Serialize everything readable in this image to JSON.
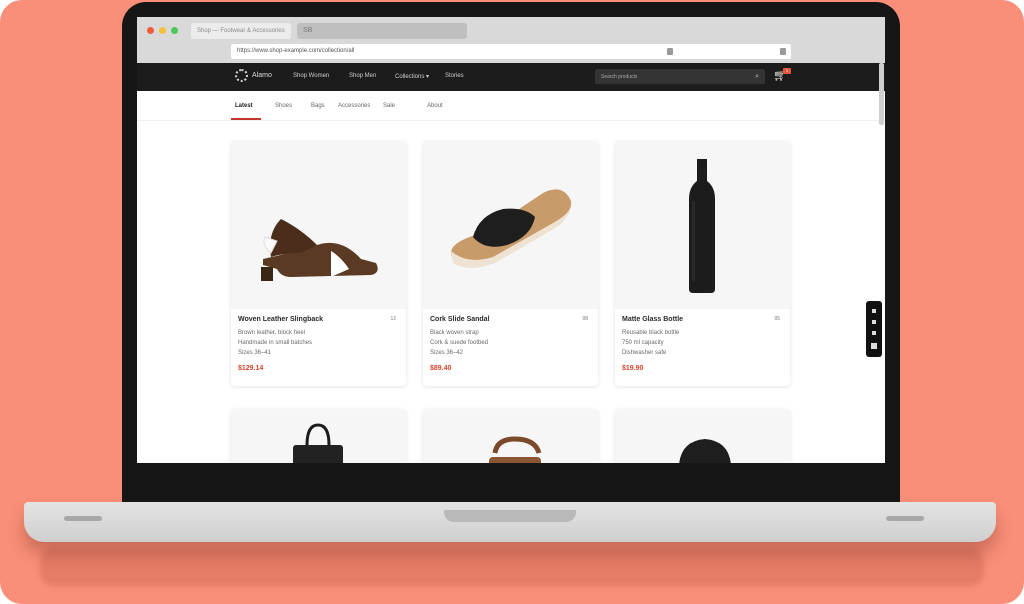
{
  "browser": {
    "tab_title": "Shop — Footwear & Accessories",
    "tab2_label": "SB",
    "url": "https://www.shop-example.com/collection/all"
  },
  "site": {
    "brand": "Alamo",
    "nav_links": [
      "Shop Women",
      "Shop Men",
      "Collections ▾",
      "Stories"
    ],
    "search_placeholder": "Search products",
    "cart_count": "1"
  },
  "subnav": {
    "tabs": [
      "Latest",
      "Shoes",
      "Bags",
      "Accessories",
      "Sale",
      "About"
    ]
  },
  "products": [
    {
      "title": "Woven Leather Slingback",
      "count": "12",
      "lines": [
        "Brown leather, block heel",
        "Handmade in small batches",
        "Sizes 36–41"
      ],
      "price": "$129.14"
    },
    {
      "title": "Cork Slide Sandal",
      "count": "08",
      "lines": [
        "Black woven strap",
        "Cork & suede footbed",
        "Sizes 36–42"
      ],
      "price": "$89.40"
    },
    {
      "title": "Matte Glass Bottle",
      "count": "05",
      "lines": [
        "Reusable black bottle",
        "750 ml capacity",
        "Dishwasher safe"
      ],
      "price": "$19.90"
    }
  ],
  "colors": {
    "backdrop": "#f98f78",
    "accent": "#d9442a",
    "nav_bg": "#1c1c1c"
  }
}
